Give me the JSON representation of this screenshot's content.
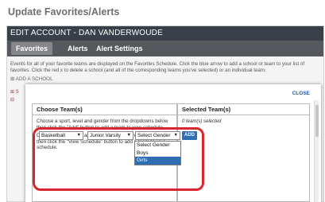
{
  "page_heading": "Update Favorites/Alerts",
  "account_bar": {
    "title": "EDIT ACCOUNT - DAN VANDERWOUDE"
  },
  "tabs": [
    "Favorites",
    "Alerts",
    "Alert Settings"
  ],
  "background": {
    "info_text": "Events for all of your favorite teams are displayed on the Favorites Schedule. Click the blue arrow to add a school or team to your list of favorites. Click the red x to delete a school (and all of the corresponding teams you've selected) or an individual team.",
    "add_school": "⊞ ADD A SCHOOL",
    "frag_1": "⊞ S",
    "frag_2": "⊟"
  },
  "modal": {
    "close_label": "CLOSE",
    "choose_header": "Choose Team(s)",
    "selected_header": "Selected Team(s)",
    "instruction_1": "Choose a sport, level and gender from the dropdowns below then click the \"Add\" button to add a team to your schedule.",
    "instruction_2": "Choose a sport, level and gender from the dropdowns below then click the \"View Schedule\" button to add a team to your schedule.",
    "selected_status": "0 team(s) selected",
    "sport_value": "Basketball",
    "level_value": "Junior Varsity",
    "gender_value": "Select Gender",
    "add_label": "ADD",
    "gender_options": [
      "Select Gender",
      "Boys",
      "Girls"
    ],
    "gender_highlighted_index": 2
  },
  "colors": {
    "header_bar": "#3a4049",
    "tab_bar": "#55595e",
    "accent_blue": "#2f6db5",
    "highlight_red": "#d8262e"
  }
}
